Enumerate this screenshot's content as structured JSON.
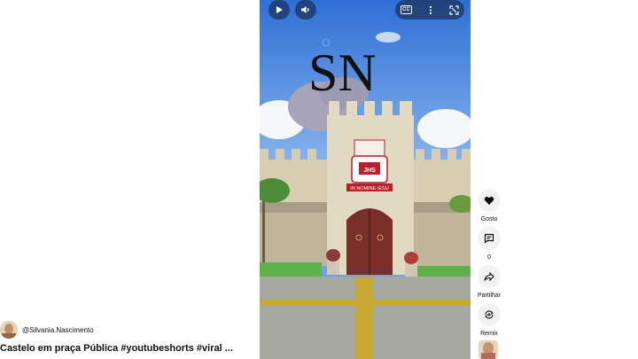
{
  "channel": {
    "handle": "@Silvania.Nascimento"
  },
  "video": {
    "title": "Castelo em praça Pública #youtubeshorts #viral ..."
  },
  "controls": {
    "play_icon": "play-icon",
    "volume_icon": "volume-icon",
    "captions_label": "CC",
    "more_icon": "more-vert-icon",
    "fullscreen_icon": "fullscreen-icon"
  },
  "actions": {
    "like": {
      "label": "Gosto",
      "icon": "thumb-up-icon"
    },
    "comments": {
      "label": "0",
      "icon": "comment-icon"
    },
    "share": {
      "label": "Partilhar",
      "icon": "share-icon"
    },
    "remix": {
      "label": "Remix",
      "icon": "remix-icon"
    }
  },
  "overlay": {
    "logo_text": "SN",
    "crest_text": "JHS",
    "banner_text": "IN NOMINE IESU"
  },
  "colors": {
    "sky": "#3f7ddd",
    "wall": "#e2d9c2",
    "door": "#7a2e2a",
    "grass": "#5db34a",
    "accent": "#b8202a"
  }
}
